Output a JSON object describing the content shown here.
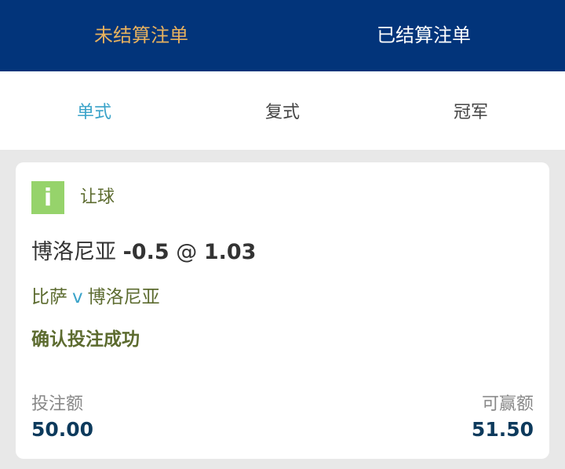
{
  "top_tabs": [
    {
      "label": "未结算注单",
      "active": true
    },
    {
      "label": "已结算注单",
      "active": false
    }
  ],
  "sub_tabs": [
    {
      "label": "单式",
      "active": true
    },
    {
      "label": "复式",
      "active": false
    },
    {
      "label": "冠军",
      "active": false
    }
  ],
  "bet": {
    "market_icon_text": "i",
    "market": "让球",
    "selection_team": "博洛尼亚",
    "handicap": "-0.5",
    "at_symbol": "@",
    "odds": "1.03",
    "home_team": "比萨",
    "vs": "v",
    "away_team": "博洛尼亚",
    "status": "确认投注成功",
    "stake_label": "投注额",
    "stake_value": "50.00",
    "payout_label": "可赢额",
    "payout_value": "51.50"
  },
  "colors": {
    "header_bg": "#02347a",
    "active_top_tab": "#e7b15e",
    "active_sub_tab": "#3aa3c9",
    "market_icon": "#96d36b",
    "amount_value": "#0d3a5c"
  }
}
